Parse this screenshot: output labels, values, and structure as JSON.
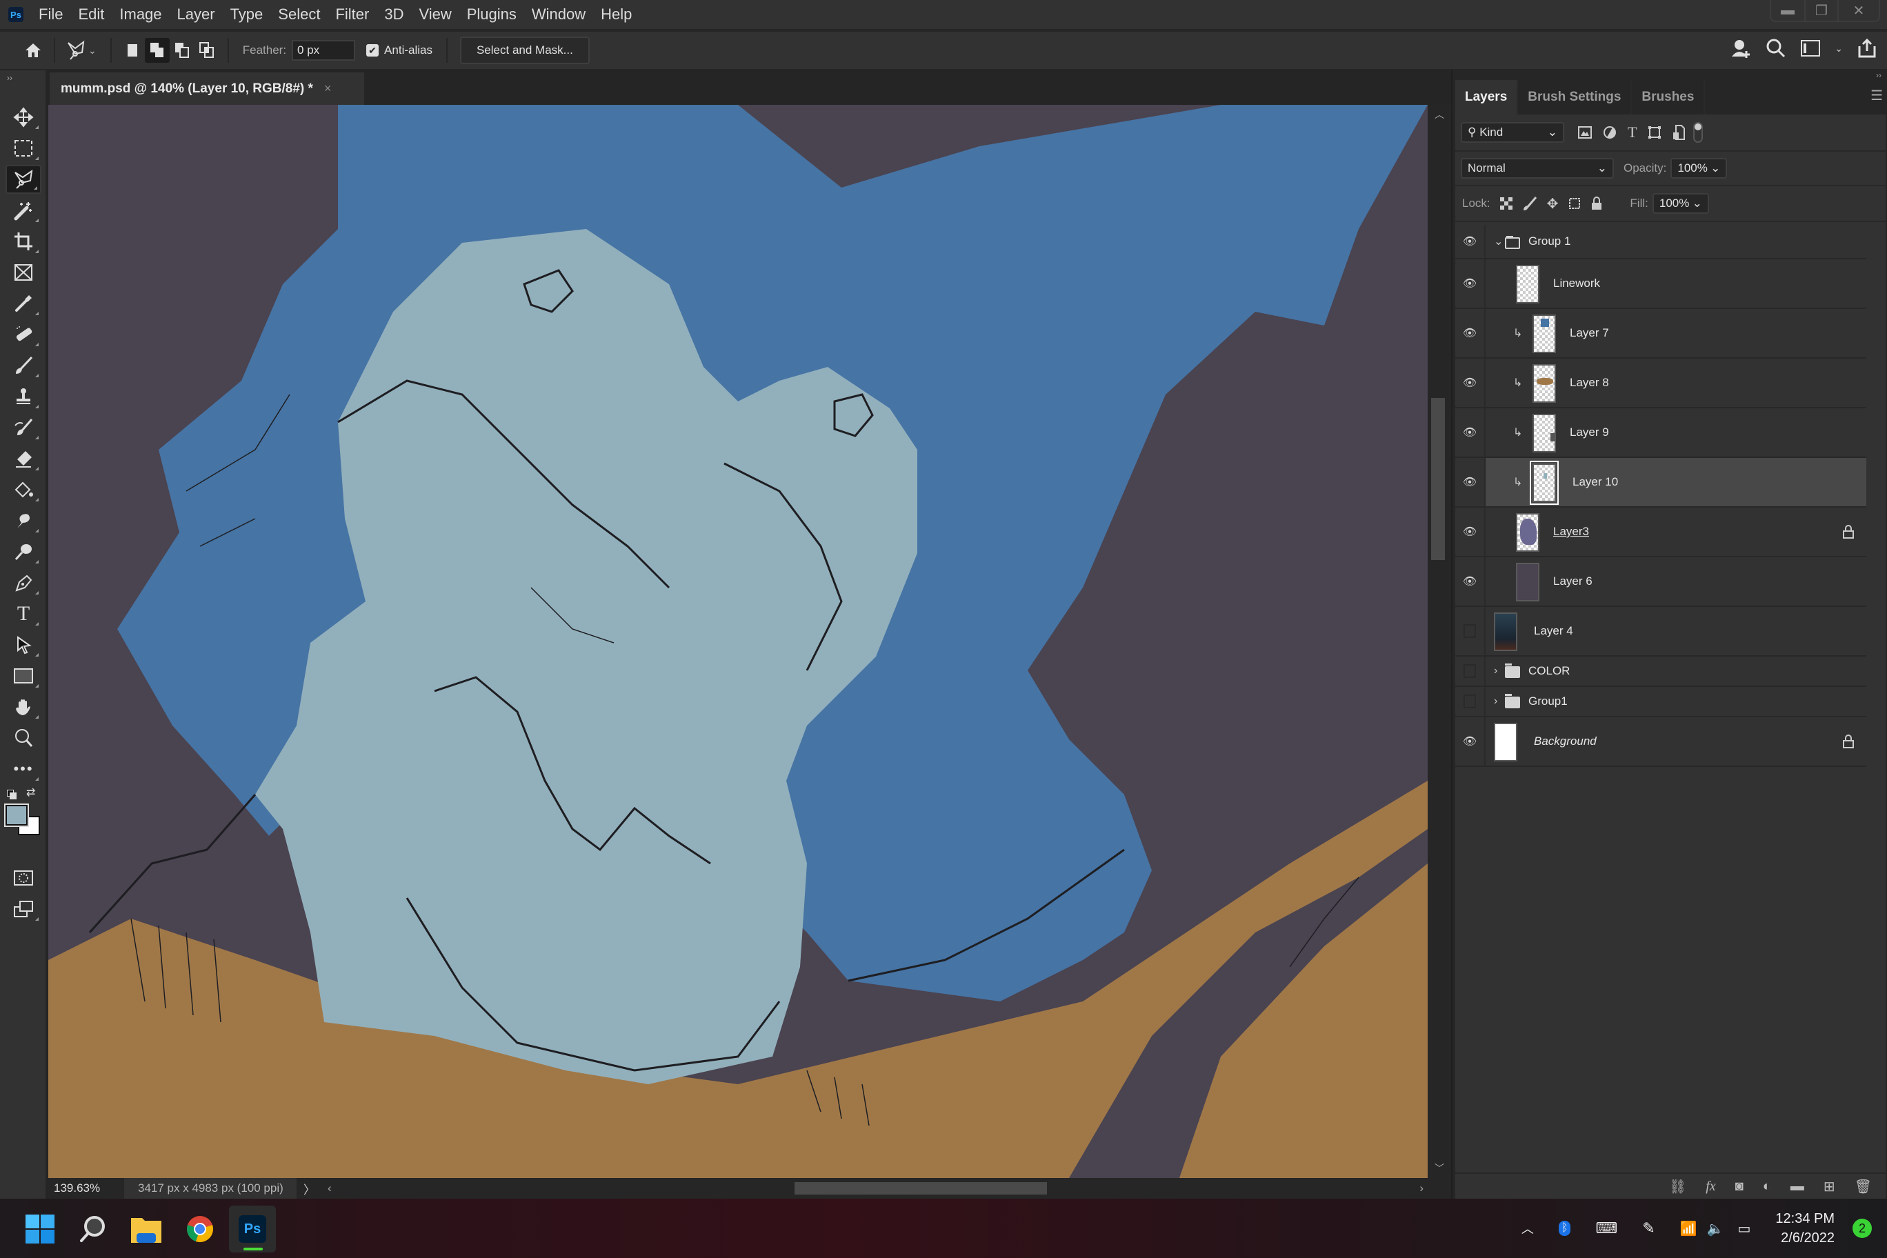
{
  "app": {
    "name": "Photoshop",
    "logo": "Ps"
  },
  "menu": [
    "File",
    "Edit",
    "Image",
    "Layer",
    "Type",
    "Select",
    "Filter",
    "3D",
    "View",
    "Plugins",
    "Window",
    "Help"
  ],
  "window_controls": {
    "minimize": "minimize-icon",
    "restore": "restore-icon",
    "close": "close-icon"
  },
  "options_bar": {
    "tool": "polygonal-lasso",
    "selection_modes": [
      "new-selection",
      "add-to-selection",
      "subtract-from-selection",
      "intersect-with-selection"
    ],
    "active_mode": "add-to-selection",
    "feather_label": "Feather:",
    "feather_value": "0 px",
    "antialias_label": "Anti-alias",
    "antialias_checked": true,
    "select_mask_label": "Select and Mask...",
    "right_icons": [
      "invite-icon",
      "search-icon",
      "workspace-icon",
      "share-icon"
    ]
  },
  "document": {
    "tab_title": "mumm.psd @ 140% (Layer 10, RGB/8#) *",
    "close": "×",
    "zoom": "139.63%",
    "info": "3417 px x 4983 px (100 ppi)",
    "canvas_colors": {
      "background": "#4a4350",
      "rock": "#4674a4",
      "figure": "#92b0bc",
      "ground": "#a07848",
      "line": "#1e1e22"
    }
  },
  "tools": [
    "move",
    "rectangular-marquee",
    "polygonal-lasso",
    "magic-wand",
    "crop",
    "frame",
    "eyedropper",
    "healing-brush",
    "brush",
    "clone-stamp",
    "history-brush",
    "eraser",
    "paint-bucket",
    "smudge",
    "dodge",
    "pen",
    "type",
    "path-selection",
    "rectangle",
    "hand",
    "zoom",
    "more",
    "default-colors",
    "swap-colors",
    "quick-mask",
    "screen-mode"
  ],
  "active_tool": "polygonal-lasso",
  "colors": {
    "foreground": "#94b0bc",
    "background": "#ffffff"
  },
  "panel": {
    "tabs": [
      "Layers",
      "Brush Settings",
      "Brushes"
    ],
    "active_tab": "Layers",
    "filter_kind": "Kind",
    "blend_mode": "Normal",
    "opacity_label": "Opacity:",
    "opacity": "100%",
    "lock_label": "Lock:",
    "fill_label": "Fill:",
    "fill": "100%",
    "layers": [
      {
        "name": "Group 1",
        "type": "group",
        "visible": true,
        "expanded": true
      },
      {
        "name": "Linework",
        "type": "layer",
        "visible": true,
        "indent": 1
      },
      {
        "name": "Layer 7",
        "type": "layer",
        "visible": true,
        "indent": 1,
        "clipped": true,
        "thumb_color": "#4674a4"
      },
      {
        "name": "Layer 8",
        "type": "layer",
        "visible": true,
        "indent": 1,
        "clipped": true,
        "thumb_color": "#a07848"
      },
      {
        "name": "Layer 9",
        "type": "layer",
        "visible": true,
        "indent": 1,
        "clipped": true,
        "thumb_color": "#555555"
      },
      {
        "name": "Layer 10",
        "type": "layer",
        "visible": true,
        "indent": 1,
        "clipped": true,
        "selected": true,
        "thumb_color": "#92b0bc"
      },
      {
        "name": "Layer3",
        "type": "layer",
        "visible": true,
        "indent": 1,
        "locked": true,
        "thumb_color": "#6a6890"
      },
      {
        "name": "Layer 6",
        "type": "layer",
        "visible": true,
        "indent": 1,
        "thumb_color": "#4a4350"
      },
      {
        "name": "Layer 4",
        "type": "layer",
        "visible": false
      },
      {
        "name": "COLOR",
        "type": "group",
        "visible": false,
        "expanded": false
      },
      {
        "name": "Group1",
        "type": "group",
        "visible": false,
        "expanded": false
      },
      {
        "name": "Background",
        "type": "layer",
        "visible": true,
        "locked": true,
        "thumb_color": "#ffffff"
      }
    ],
    "footer_icons": [
      "link-icon",
      "fx-icon",
      "mask-icon",
      "adjustment-icon",
      "new-group-icon",
      "new-layer-icon",
      "delete-icon"
    ]
  },
  "taskbar": {
    "apps": [
      "start",
      "search",
      "file-explorer",
      "chrome",
      "photoshop"
    ],
    "active_app": "photoshop",
    "time": "12:34 PM",
    "date": "2/6/2022",
    "notifications": "2"
  }
}
